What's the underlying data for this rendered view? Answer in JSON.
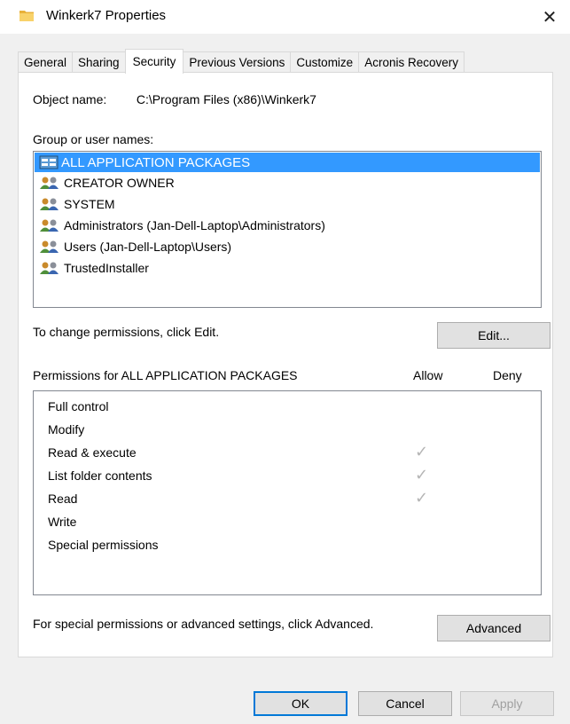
{
  "window": {
    "title": "Winkerk7 Properties",
    "close_label": "✕",
    "icon": "folder-icon"
  },
  "tabs": [
    {
      "label": "General",
      "active": false
    },
    {
      "label": "Sharing",
      "active": false
    },
    {
      "label": "Security",
      "active": true
    },
    {
      "label": "Previous Versions",
      "active": false
    },
    {
      "label": "Customize",
      "active": false
    },
    {
      "label": "Acronis Recovery",
      "active": false
    }
  ],
  "security": {
    "object_label": "Object name:",
    "object_value": "C:\\Program Files (x86)\\Winkerk7",
    "group_label": "Group or user names:",
    "groups": [
      {
        "name": "ALL APPLICATION PACKAGES",
        "icon": "app-packages-icon",
        "selected": true
      },
      {
        "name": "CREATOR OWNER",
        "icon": "users-group-icon",
        "selected": false
      },
      {
        "name": "SYSTEM",
        "icon": "users-group-icon",
        "selected": false
      },
      {
        "name": "Administrators (Jan-Dell-Laptop\\Administrators)",
        "icon": "users-group-icon",
        "selected": false
      },
      {
        "name": "Users (Jan-Dell-Laptop\\Users)",
        "icon": "users-group-icon",
        "selected": false
      },
      {
        "name": "TrustedInstaller",
        "icon": "users-group-icon",
        "selected": false
      }
    ],
    "change_text": "To change permissions, click Edit.",
    "edit_button": "Edit...",
    "permissions_title": "Permissions for ALL APPLICATION PACKAGES",
    "allow_label": "Allow",
    "deny_label": "Deny",
    "permissions": [
      {
        "name": "Full control",
        "allow": "",
        "deny": ""
      },
      {
        "name": "Modify",
        "allow": "",
        "deny": ""
      },
      {
        "name": "Read & execute",
        "allow": "✓",
        "deny": ""
      },
      {
        "name": "List folder contents",
        "allow": "✓",
        "deny": ""
      },
      {
        "name": "Read",
        "allow": "✓",
        "deny": ""
      },
      {
        "name": "Write",
        "allow": "",
        "deny": ""
      },
      {
        "name": "Special permissions",
        "allow": "",
        "deny": ""
      }
    ],
    "advanced_text": "For special permissions or advanced settings, click Advanced.",
    "advanced_button": "Advanced"
  },
  "footer": {
    "ok": "OK",
    "cancel": "Cancel",
    "apply": "Apply"
  },
  "colors": {
    "selection": "#3399ff",
    "dialog_bg": "#f0f0f0",
    "default_button_border": "#0078d7"
  }
}
